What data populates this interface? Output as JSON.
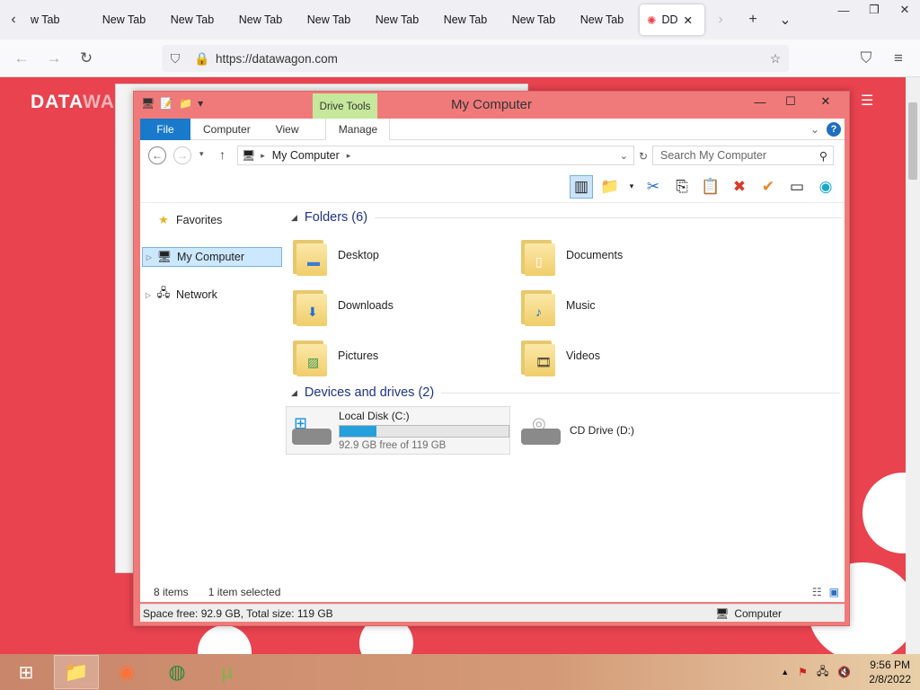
{
  "browser": {
    "tabs": [
      "w Tab",
      "New Tab",
      "New Tab",
      "New Tab",
      "New Tab",
      "New Tab",
      "New Tab",
      "New Tab",
      "New Tab"
    ],
    "active_tab": "DD",
    "url": "https://datawagon.com"
  },
  "page": {
    "brand_a": "DATA",
    "brand_b": "WA"
  },
  "explorer": {
    "title": "My Computer",
    "drive_tools": "Drive Tools",
    "ribbon_tabs": [
      "File",
      "Computer",
      "View",
      "Manage"
    ],
    "address": "My Computer",
    "search_placeholder": "Search My Computer",
    "nav": {
      "favorites": "Favorites",
      "my_computer": "My Computer",
      "network": "Network"
    },
    "folders_header": "Folders (6)",
    "folders": [
      "Desktop",
      "Documents",
      "Downloads",
      "Music",
      "Pictures",
      "Videos"
    ],
    "devices_header": "Devices and drives (2)",
    "drives": {
      "c_name": "Local Disk (C:)",
      "c_free": "92.9 GB free of 119 GB",
      "c_used_fraction": 0.22,
      "d_name": "CD Drive (D:)"
    },
    "status_items": "8 items",
    "status_selected": "1 item selected",
    "footer_space": "Space free: 92.9 GB, Total size: 119 GB",
    "footer_location": "Computer"
  },
  "taskbar": {
    "time": "9:56 PM",
    "date": "2/8/2022"
  }
}
